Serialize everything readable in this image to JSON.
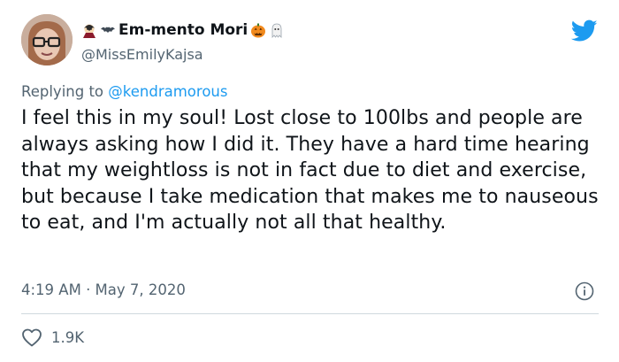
{
  "author": {
    "display_name": "Em-mento Mori",
    "handle": "@MissEmilyKajsa",
    "emoji_before": [
      "vampire-emoji",
      "bat-emoji"
    ],
    "emoji_after": [
      "jack-o-lantern-emoji",
      "ghost-emoji"
    ]
  },
  "reply": {
    "prefix": "Replying to",
    "mention": "@kendramorous"
  },
  "tweet": {
    "text": "I feel this in my soul! Lost close to 100lbs and people are always asking how I did it. They have a hard time hearing that my weightloss is not in fact due to diet and exercise, but because I take medication that makes me to nauseous to eat, and I'm actually not all that healthy.",
    "timestamp": "4:19 AM · May 7, 2020"
  },
  "actions": {
    "like_count": "1.9K"
  },
  "icons": {
    "brand": "twitter-bird-icon",
    "info": "info-icon",
    "like": "heart-icon"
  },
  "colors": {
    "brand_blue": "#1d9bf0",
    "secondary_text": "#536471",
    "primary_text": "#0f1419",
    "divider": "#cfd9de"
  }
}
